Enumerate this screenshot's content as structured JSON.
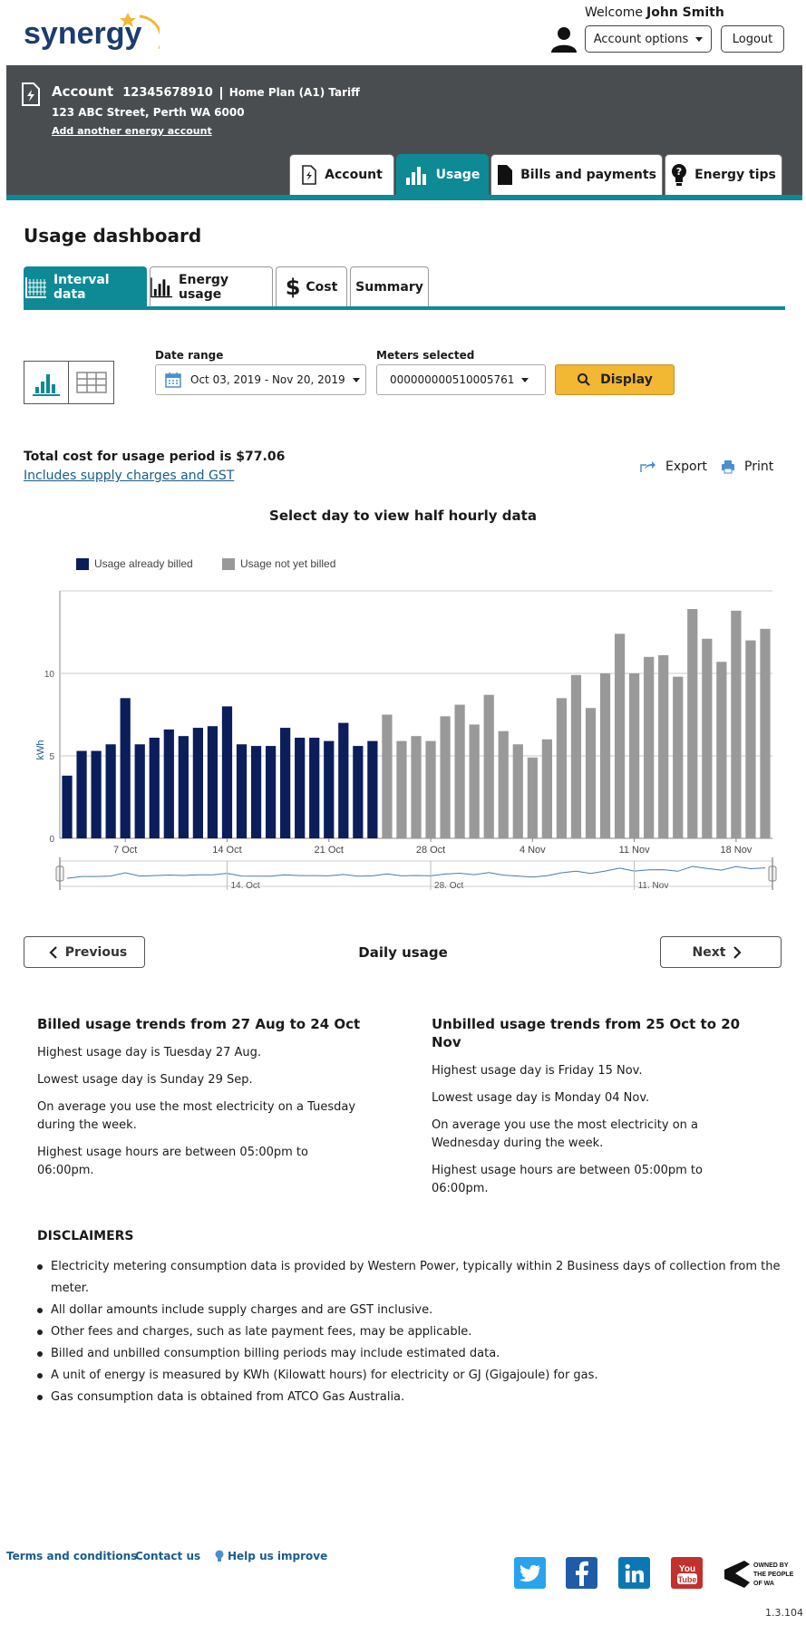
{
  "brand": {
    "name": "synergy",
    "accent": "#0e8a96",
    "navy": "#0b1e5b",
    "gold": "#f2b733"
  },
  "header": {
    "welcome_label": "Welcome",
    "user_name": "John Smith",
    "account_options_label": "Account options",
    "logout_label": "Logout"
  },
  "account": {
    "label": "Account",
    "number": "12345678910",
    "plan": "Home Plan (A1) Tariff",
    "address": "123 ABC Street, Perth WA 6000",
    "add_link": "Add another energy account"
  },
  "main_tabs": [
    {
      "label": "Account",
      "icon": "document-bolt-icon",
      "active": false
    },
    {
      "label": "Usage",
      "icon": "bar-chart-icon",
      "active": true
    },
    {
      "label": "Bills and payments",
      "icon": "document-icon",
      "active": false
    },
    {
      "label": "Energy tips",
      "icon": "lightbulb-icon",
      "active": false
    }
  ],
  "dashboard": {
    "title": "Usage dashboard",
    "sub_tabs": [
      {
        "label": "Interval data",
        "icon": "interval-grid-icon",
        "active": true
      },
      {
        "label": "Energy usage",
        "icon": "bar-chart-icon",
        "active": false
      },
      {
        "label": "Cost",
        "icon": "dollar-icon",
        "active": false
      },
      {
        "label": "Summary",
        "icon": "",
        "active": false
      }
    ]
  },
  "filters": {
    "date_range_label": "Date range",
    "date_range_value": "Oct 03, 2019 - Nov 20, 2019",
    "meters_label": "Meters selected",
    "meters_value": "000000000510005761",
    "display_label": "Display"
  },
  "summary": {
    "total_cost": "Total cost for usage period is $77.06",
    "includes_link": "Includes supply charges and GST",
    "export_label": "Export",
    "print_label": "Print"
  },
  "chart_heading": "Select day to view half hourly data",
  "chart_data": {
    "type": "bar",
    "ylabel": "kWh",
    "ylim": [
      0,
      15
    ],
    "yticks": [
      0,
      5,
      10
    ],
    "xticks": [
      {
        "label": "7 Oct",
        "index": 4
      },
      {
        "label": "14 Oct",
        "index": 11
      },
      {
        "label": "21 Oct",
        "index": 18
      },
      {
        "label": "28 Oct",
        "index": 25
      },
      {
        "label": "4 Nov",
        "index": 32
      },
      {
        "label": "11 Nov",
        "index": 39
      },
      {
        "label": "18 Nov",
        "index": 46
      }
    ],
    "navigator_ticks": [
      {
        "label": "14. Oct",
        "index": 11
      },
      {
        "label": "28. Oct",
        "index": 25
      },
      {
        "label": "11. Nov",
        "index": 39
      }
    ],
    "series": [
      {
        "name": "Usage already billed",
        "color": "#0b1e5b",
        "values": [
          3.8,
          5.3,
          5.3,
          5.7,
          8.5,
          5.7,
          6.1,
          6.6,
          6.2,
          6.7,
          6.8,
          8.0,
          5.7,
          5.6,
          5.6,
          6.7,
          6.1,
          6.1,
          5.9,
          7.0,
          5.6,
          5.9
        ]
      },
      {
        "name": "Usage not yet billed",
        "color": "#999999",
        "values": [
          7.5,
          5.9,
          6.2,
          5.9,
          7.4,
          8.1,
          6.9,
          8.7,
          6.5,
          5.7,
          4.9,
          6.0,
          8.5,
          9.9,
          7.9,
          10.0,
          12.4,
          10.0,
          11.0,
          11.1,
          9.8,
          13.9,
          12.1,
          10.7,
          13.8,
          12.0,
          12.7
        ]
      }
    ]
  },
  "daily": {
    "previous_label": "Previous",
    "title": "Daily usage",
    "next_label": "Next"
  },
  "trends": {
    "billed": {
      "title": "Billed usage trends from 27 Aug to 24 Oct",
      "lines": [
        "Highest usage day is Tuesday 27 Aug.",
        "Lowest usage day is Sunday 29 Sep.",
        "On average you use the most electricity on a Tuesday during the week.",
        "Highest usage hours are between 05:00pm to 06:00pm."
      ]
    },
    "unbilled": {
      "title": "Unbilled usage trends from 25 Oct to 20 Nov",
      "lines": [
        "Highest usage day is Friday 15 Nov.",
        "Lowest usage day is Monday 04 Nov.",
        "On average you use the most electricity on a Wednesday during the week.",
        "Highest usage hours are between 05:00pm to 06:00pm."
      ]
    }
  },
  "disclaimers": {
    "title": "DISCLAIMERS",
    "items": [
      "Electricity metering consumption data is provided by Western Power, typically within 2 Business days of collection from the meter.",
      "All dollar amounts include supply charges and are GST inclusive.",
      "Other fees and charges, such as late payment fees, may be applicable.",
      "Billed and unbilled consumption billing periods may include estimated data.",
      "A unit of energy is measured by KWh (Kilowatt hours) for electricity or GJ (Gigajoule) for gas.",
      "Gas consumption data is obtained from ATCO Gas Australia."
    ]
  },
  "footer": {
    "terms_label": "Terms and conditions",
    "contact_label": "Contact us",
    "help_label": "Help us improve",
    "owned_line1": "OWNED BY",
    "owned_line2": "THE PEOPLE",
    "owned_line3": "OF WA",
    "version": "1.3.104",
    "social": [
      {
        "name": "twitter",
        "color": "#2aa3ef"
      },
      {
        "name": "facebook",
        "color": "#1f5ba8"
      },
      {
        "name": "linkedin",
        "color": "#0b78b5"
      },
      {
        "name": "youtube",
        "color": "#c4302b"
      }
    ]
  }
}
